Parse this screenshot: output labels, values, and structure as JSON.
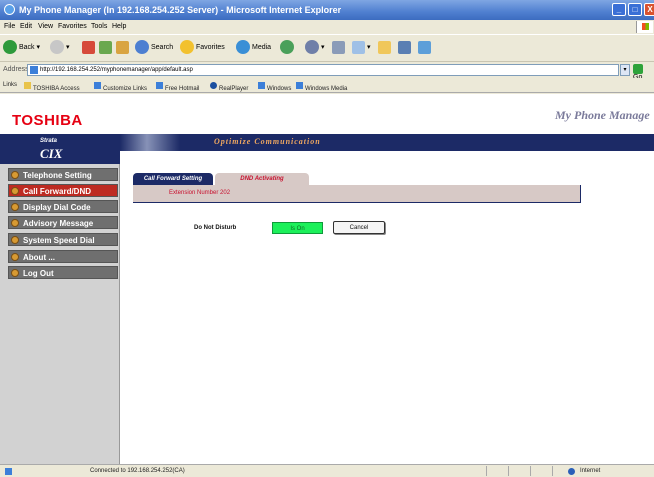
{
  "window": {
    "title": "My Phone Manager (In 192.168.254.252 Server) - Microsoft Internet Explorer",
    "min": "_",
    "max": "□",
    "close": "X"
  },
  "menu": [
    "File",
    "Edit",
    "View",
    "Favorites",
    "Tools",
    "Help"
  ],
  "toolbar": {
    "back": "Back",
    "search": "Search",
    "favorites": "Favorites",
    "media": "Media"
  },
  "address": {
    "label": "Address",
    "url": "http://192.168.254.252/myphonemanager/app/default.asp",
    "go": "Go"
  },
  "links": [
    {
      "label": "Links"
    },
    {
      "label": "TOSHIBA Access"
    },
    {
      "label": "Customize Links"
    },
    {
      "label": "Free Hotmail"
    },
    {
      "label": "RealPlayer"
    },
    {
      "label": "Windows"
    },
    {
      "label": "Windows Media"
    }
  ],
  "sidebar": {
    "brand": "TOSHIBA",
    "product_top": "Strata",
    "product": "CIX",
    "items": [
      {
        "label": "Telephone Setting",
        "active": false
      },
      {
        "label": "Call Forward/DND",
        "active": true
      },
      {
        "label": "Display Dial Code",
        "active": false
      },
      {
        "label": "Advisory Message",
        "active": false
      },
      {
        "label": "System Speed Dial",
        "active": false
      },
      {
        "label": "About ...",
        "active": false
      },
      {
        "label": "Log Out",
        "active": false
      }
    ]
  },
  "main": {
    "app_title": "My Phone Manage",
    "banner": "Optimize Communication",
    "tabs": [
      {
        "label": "Call Forward Setting"
      },
      {
        "label": "DND Activating"
      }
    ],
    "extension": "Extension Number 202",
    "dnd_label": "Do Not Disturb",
    "dnd_status": "Is On",
    "cancel": "Cancel"
  },
  "status": {
    "text": "Connected to 192.168.254.252(CA)",
    "zone": "Internet"
  }
}
